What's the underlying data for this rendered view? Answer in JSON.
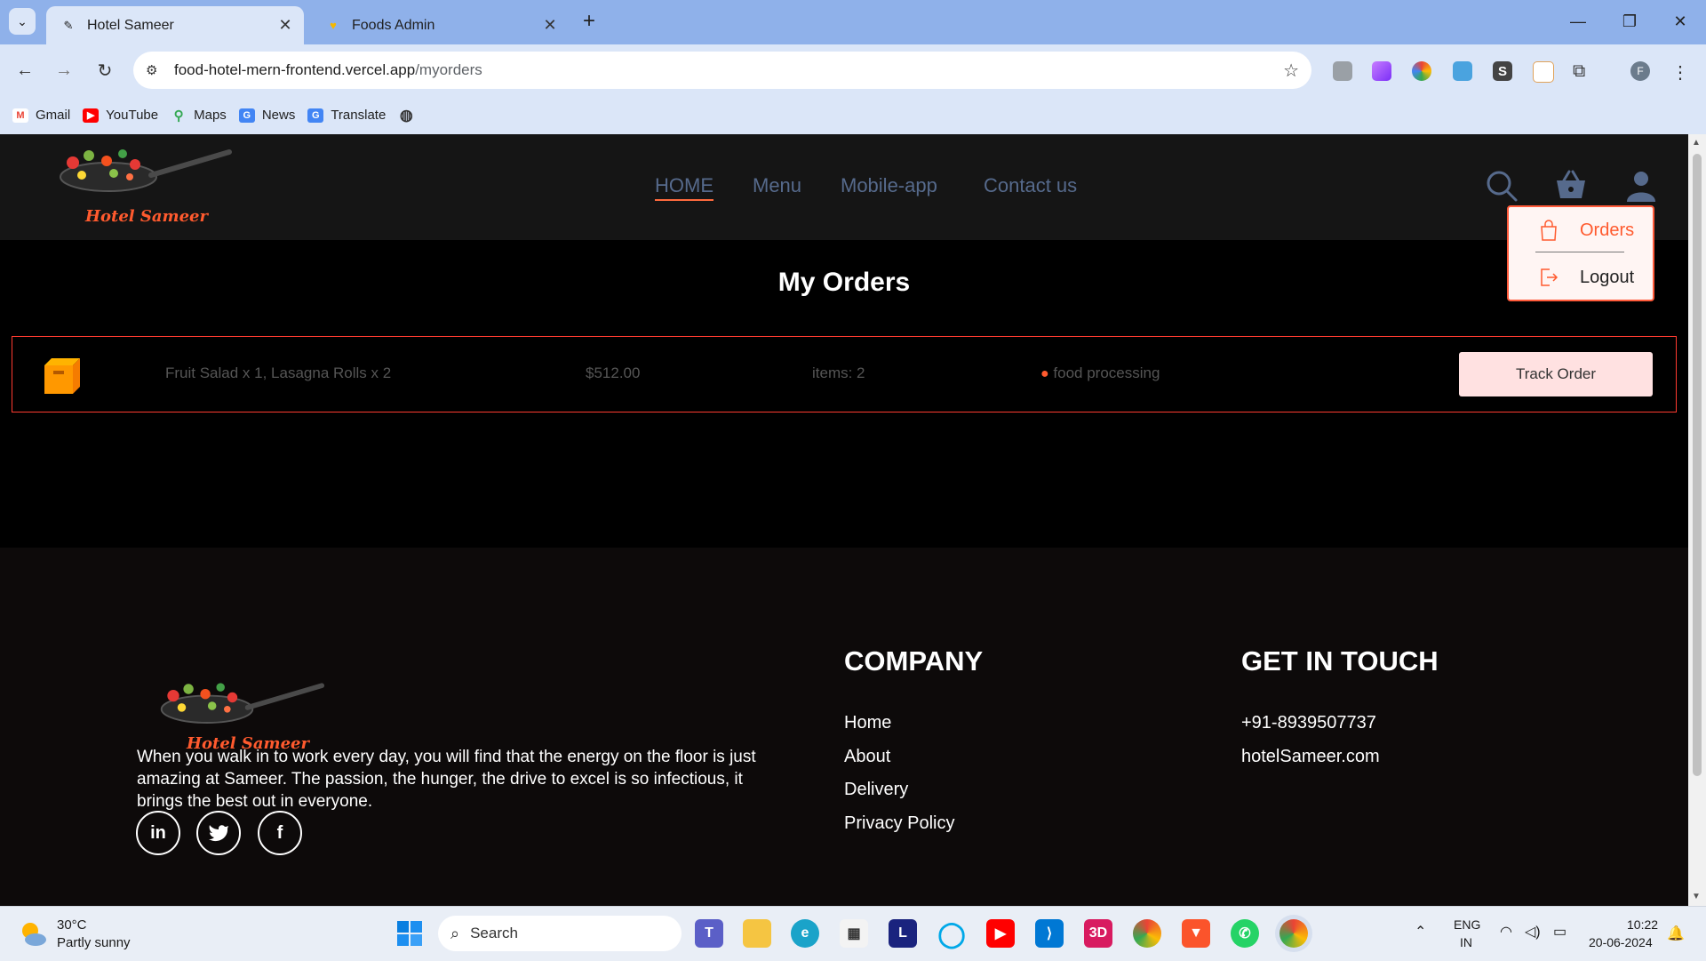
{
  "browser": {
    "tabs": [
      {
        "title": "Hotel Sameer",
        "active": true
      },
      {
        "title": "Foods Admin",
        "active": false
      }
    ],
    "url_host": "food-hotel-mern-frontend.vercel.app",
    "url_path": "/myorders",
    "bookmarks": [
      "Gmail",
      "YouTube",
      "Maps",
      "News",
      "Translate"
    ],
    "profile_initial": "F"
  },
  "site": {
    "brand": "Hotel Sameer",
    "nav": [
      "HOME",
      "Menu",
      "Mobile-app",
      "Contact us"
    ],
    "dropdown": {
      "orders": "Orders",
      "logout": "Logout"
    }
  },
  "orders": {
    "title": "My Orders",
    "rows": [
      {
        "items": "Fruit Salad x 1, Lasagna Rolls x 2",
        "amount": "$512.00",
        "count": "items: 2",
        "status": "food processing",
        "action": "Track Order"
      }
    ]
  },
  "footer": {
    "brand": "Hotel Sameer",
    "description": "When you walk in to work every day, you will find that the energy on the floor is just amazing at Sameer. The passion, the hunger, the drive to excel is so infectious, it brings the best out in everyone.",
    "company_heading": "COMPANY",
    "company_links": [
      "Home",
      "About",
      "Delivery",
      "Privacy Policy"
    ],
    "contact_heading": "GET IN TOUCH",
    "phone": "+91-8939507737",
    "site": "hotelSameer.com",
    "social": [
      "in",
      "twitter",
      "facebook"
    ]
  },
  "taskbar": {
    "weather_temp": "30°C",
    "weather_desc": "Partly sunny",
    "search_label": "Search",
    "lang": "ENG",
    "region": "IN",
    "time": "10:22",
    "date": "20-06-2024"
  },
  "colors": {
    "accent": "#ff5a2e",
    "nav_link": "#566a8c",
    "track_btn": "#ffe1e1"
  }
}
